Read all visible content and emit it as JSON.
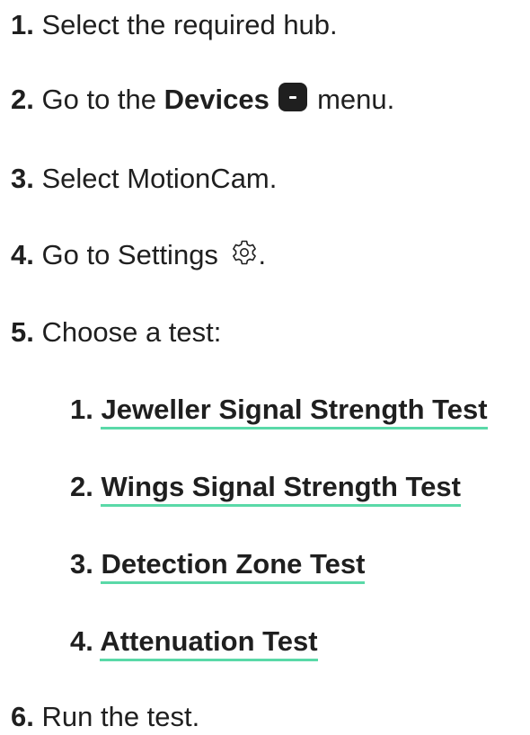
{
  "steps": [
    {
      "num": "1.",
      "text": "Select the required hub."
    },
    {
      "num": "2.",
      "text_before": "Go to the ",
      "bold_text": "Devices",
      "text_after": " menu.",
      "icon": "devices-icon"
    },
    {
      "num": "3.",
      "text": "Select MotionCam."
    },
    {
      "num": "4.",
      "text_before": "Go to Settings ",
      "text_after": ".",
      "icon": "gear-icon"
    },
    {
      "num": "5.",
      "text": "Choose a test:"
    },
    {
      "num": "6.",
      "text": "Run the test."
    }
  ],
  "tests": [
    {
      "num": "1.",
      "label": "Jeweller Signal Strength Test"
    },
    {
      "num": "2.",
      "label": "Wings Signal Strength Test"
    },
    {
      "num": "3.",
      "label": "Detection Zone Test"
    },
    {
      "num": "4.",
      "label": "Attenuation Test"
    }
  ],
  "colors": {
    "text": "#1f1f1f",
    "link_underline": "#5ad9a8"
  }
}
